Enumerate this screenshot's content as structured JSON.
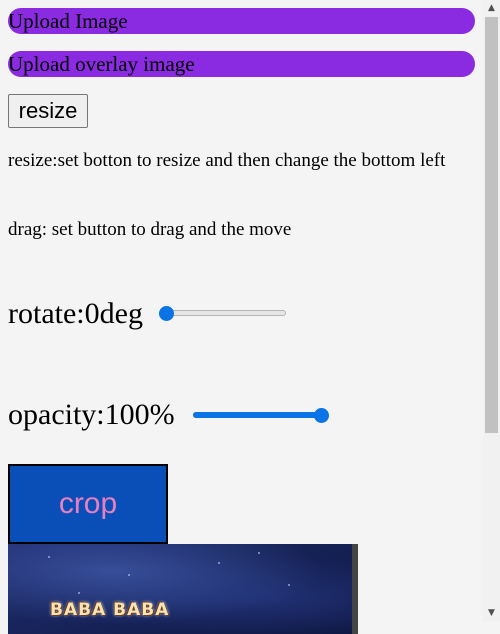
{
  "upload": {
    "image_label": "Upload Image",
    "overlay_label": "Upload overlay image",
    "bar_color": "#8a2be2"
  },
  "buttons": {
    "resize_label": "resize",
    "crop_label": "crop"
  },
  "instructions": {
    "resize_text": "resize:set botton to resize and then change the bottom left",
    "drag_text": "drag: set button to drag and the move"
  },
  "controls": {
    "rotate": {
      "label": "rotate:0deg",
      "value": 0,
      "min": 0,
      "max": 360
    },
    "opacity": {
      "label": "opacity:100%",
      "value": 100,
      "min": 0,
      "max": 100
    },
    "accent": "#0a74e6"
  },
  "canvas": {
    "logo_text": "BABA BABA"
  }
}
